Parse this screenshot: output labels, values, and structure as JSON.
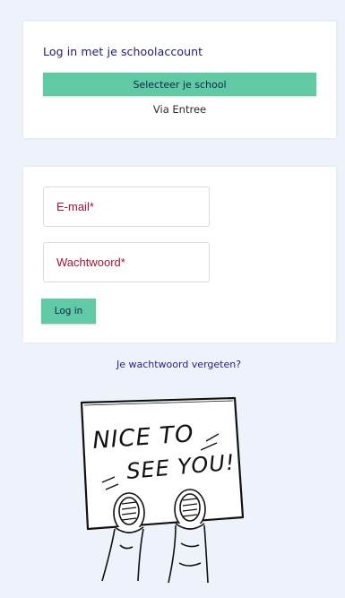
{
  "school_login": {
    "title": "Log in met je schoolaccount",
    "select_school_label": "Selecteer je school",
    "via_label": "Via Entree"
  },
  "login_form": {
    "email_placeholder": "E-mail*",
    "password_placeholder": "Wachtwoord*",
    "submit_label": "Log in"
  },
  "forgot_password_label": "Je wachtwoord vergeten?",
  "illustration": {
    "sign_text": "NICE TO SEE YOU!"
  },
  "colors": {
    "accent": "#5fcaa4",
    "background": "#eef2fb",
    "title_text": "#1f1b6e",
    "field_text": "#a21437"
  }
}
